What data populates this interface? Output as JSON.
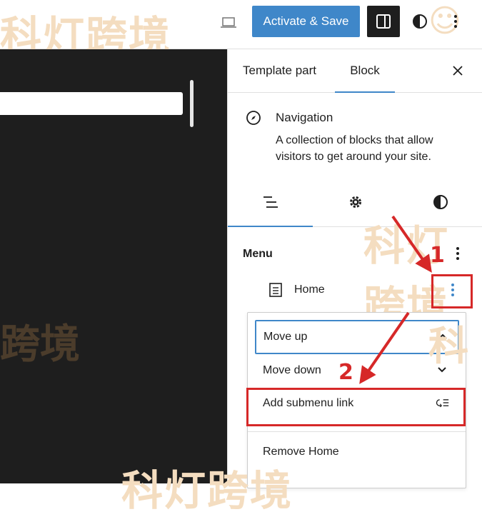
{
  "toolbar": {
    "activate_label": "Activate & Save",
    "watermark": "科灯跨境"
  },
  "sidebar_panel": {
    "tabs": [
      {
        "label": "Template part"
      },
      {
        "label": "Block",
        "active": true
      }
    ],
    "block": {
      "title": "Navigation",
      "description": "A collection of blocks that allow visitors to get around your site."
    },
    "inspector_tabs": [
      "list-view-icon",
      "gear-icon",
      "half-circle-icon"
    ],
    "menu": {
      "heading": "Menu",
      "items": [
        {
          "label": "Home",
          "icon": "page-icon"
        }
      ]
    },
    "item_dropdown": {
      "items": [
        {
          "label": "Move up",
          "icon": "chevron-up-icon"
        },
        {
          "label": "Move down",
          "icon": "chevron-down-icon"
        },
        {
          "label": "Add submenu link",
          "icon": "add-submenu-icon"
        },
        {
          "label": "Remove Home"
        }
      ]
    }
  },
  "annotations": {
    "step1": "1",
    "step2": "2",
    "color": "#d62828"
  },
  "colors": {
    "accent": "#3f87c9",
    "canvas": "#1e1e1e",
    "watermark": "#f4ddc0"
  }
}
